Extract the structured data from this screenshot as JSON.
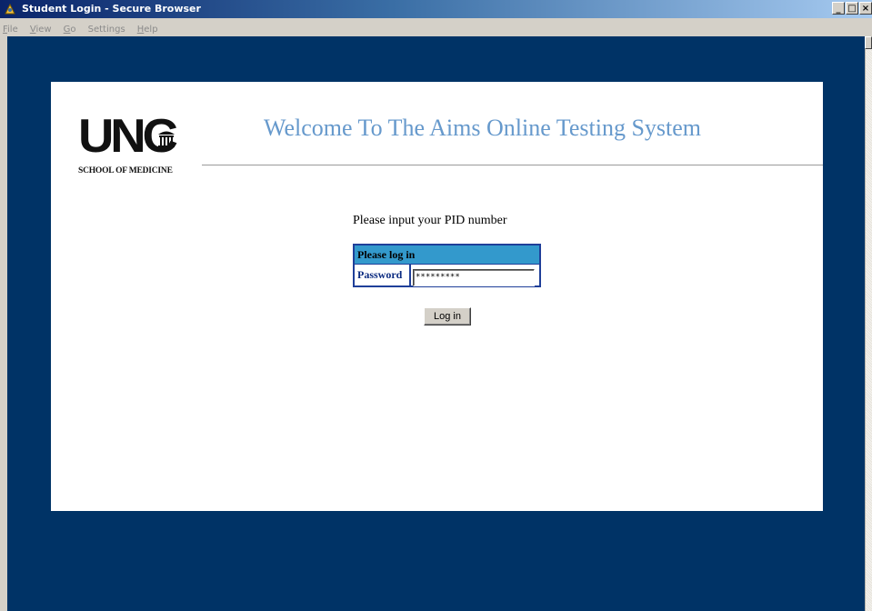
{
  "window": {
    "title": "Student Login - Secure Browser",
    "controls": [
      "_",
      "□",
      "×"
    ]
  },
  "menu": [
    {
      "label": "File",
      "key": "F",
      "rest": "ile"
    },
    {
      "label": "View",
      "key": "V",
      "rest": "iew"
    },
    {
      "label": "Go",
      "key": "G",
      "rest": "o"
    },
    {
      "label": "Settings",
      "key": "",
      "rest": "Settings"
    },
    {
      "label": "Help",
      "key": "H",
      "rest": "elp"
    }
  ],
  "logo": {
    "letters": "UNC",
    "subtitle": "SCHOOL OF MEDICINE"
  },
  "heading": "Welcome To The Aims Online Testing System",
  "prompt": "Please input your PID number",
  "login": {
    "header": "Please log in",
    "password_label": "Password",
    "password_value": "*********",
    "button": "Log in"
  },
  "colors": {
    "background": "#003366",
    "heading": "#6699cc",
    "login_header": "#3399cc",
    "border": "#1f3f99"
  }
}
